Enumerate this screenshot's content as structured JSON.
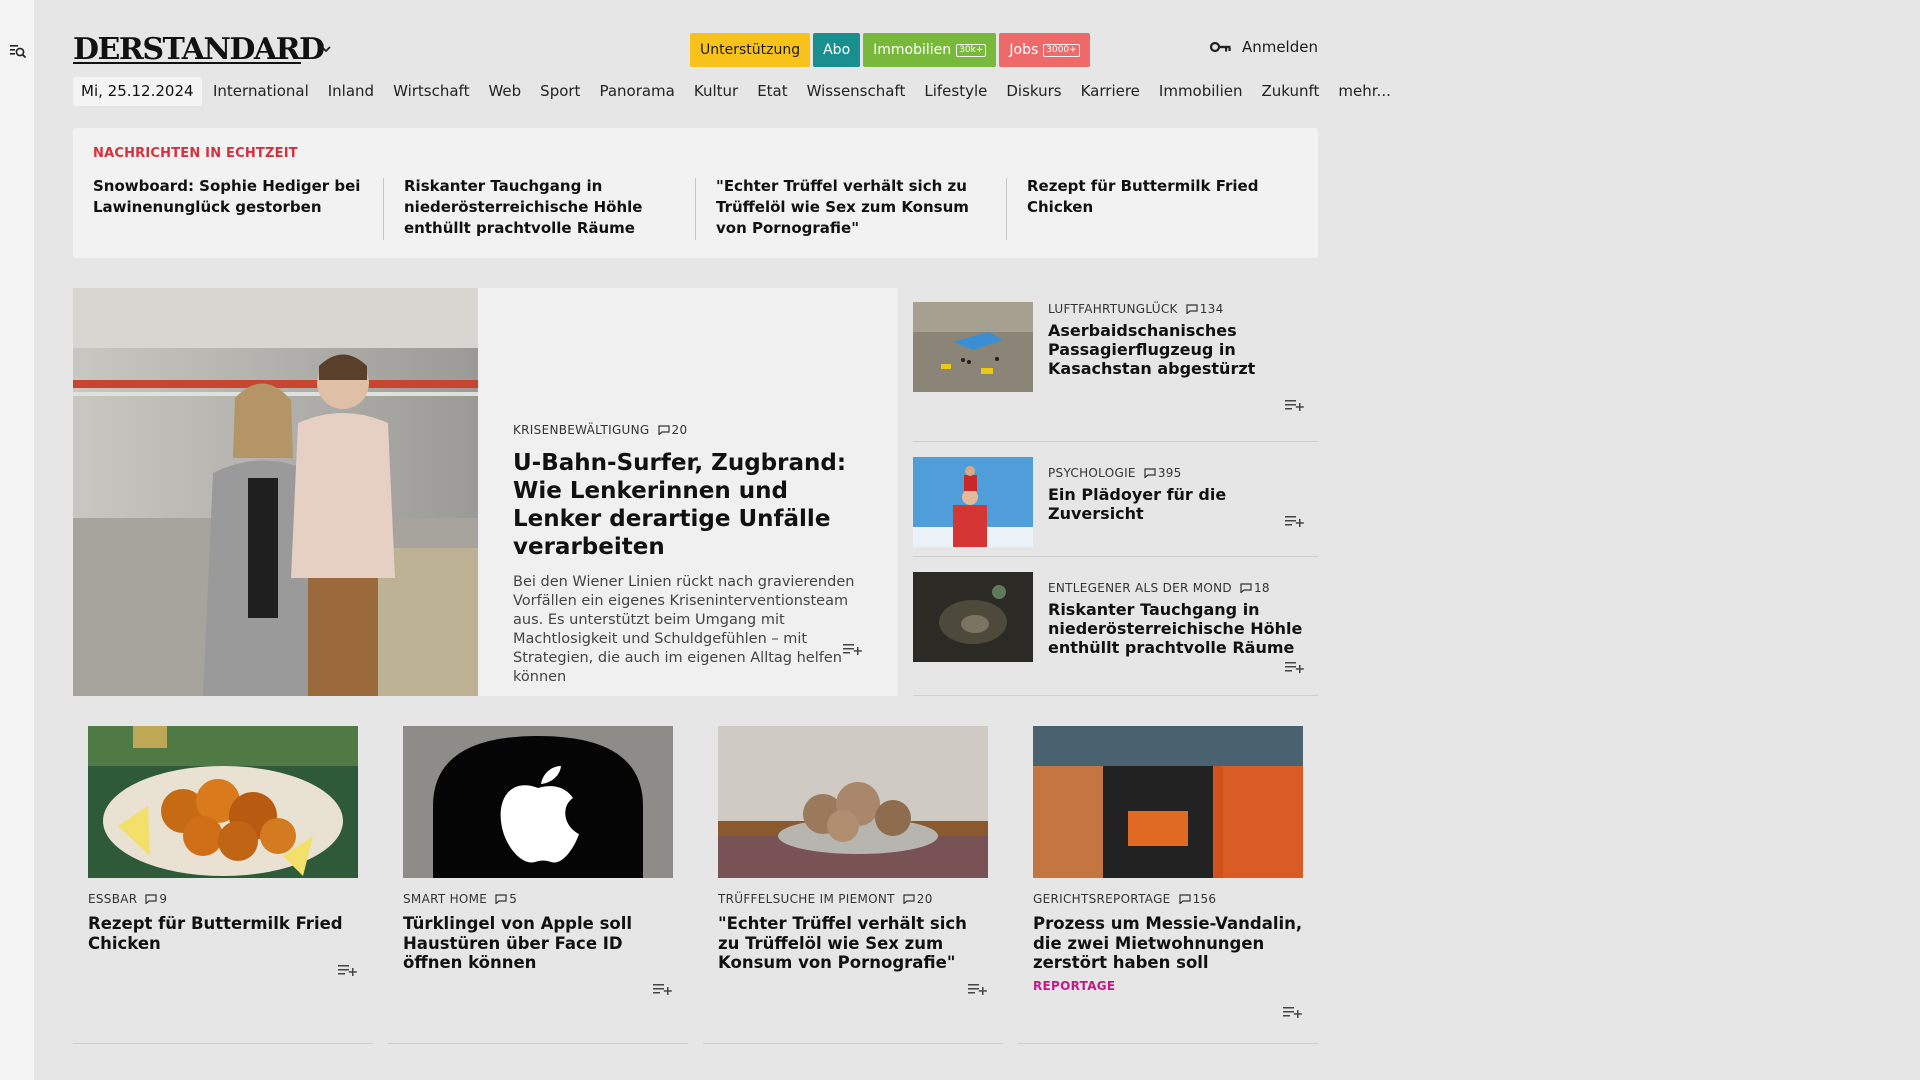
{
  "header": {
    "logo": "DERSTANDARD",
    "promo": [
      {
        "label": "Unterstützung",
        "bg": "#f7c31b",
        "fg": "#1c1c1c",
        "tag": ""
      },
      {
        "label": "Abo",
        "bg": "#1a8f8f",
        "fg": "#ffffff",
        "tag": ""
      },
      {
        "label": "Immobilien",
        "bg": "#78b93c",
        "fg": "#ffffff",
        "tag": "30k+"
      },
      {
        "label": "Jobs",
        "bg": "#ee6a6a",
        "fg": "#ffffff",
        "tag": "3000+"
      }
    ],
    "login": "Anmelden"
  },
  "nav": {
    "date": "Mi, 25.12.2024",
    "items": [
      "International",
      "Inland",
      "Wirtschaft",
      "Web",
      "Sport",
      "Panorama",
      "Kultur",
      "Etat",
      "Wissenschaft",
      "Lifestyle",
      "Diskurs",
      "Karriere",
      "Immobilien",
      "Zukunft",
      "mehr..."
    ]
  },
  "ticker": {
    "label": "NACHRICHTEN IN ECHTZEIT",
    "items": [
      "Snowboard: Sophie Hediger bei Lawi­nenunglück gestorben",
      "Riskanter Tauchgang in niederöster­reichische Höhle enthüllt prachtvolle Räume",
      "\"Echter Trüffel verhält sich zu Trüf­felöl wie Sex zum Konsum von Pornografie\"",
      "Rezept für Buttermilk Fried Chicken"
    ]
  },
  "hero": {
    "kicker": "KRISENBEWÄLTIGUNG",
    "comments": "20",
    "title": "U-Bahn-Surfer, Zugbrand: Wie Lenkerinnen und Lenker derartige Unfälle verarbeiten",
    "lead": "Bei den Wiener Linien rückt nach gravierenden Vorfällen ein eigenes Kriseninterventionsteam aus. Es unterstützt beim Umgang mit Machtlosigkeit und Schuldgefühlen – mit Strategien, die auch im eigenen Alltag helfen können"
  },
  "side": [
    {
      "kicker": "LUFTFAHRTUNGLÜCK",
      "comments": "134",
      "title": "Aserbaidschanisches Passagier­flugzeug in Kasachstan abgestürzt"
    },
    {
      "kicker": "PSYCHOLOGIE",
      "comments": "395",
      "title": "Ein Plädoyer für die Zuversicht"
    },
    {
      "kicker": "ENTLEGENER ALS DER MOND",
      "comments": "18",
      "title": "Riskanter Tauchgang in niederös­terreichische Höhle enthüllt prachtvolle Räume"
    }
  ],
  "cards": [
    {
      "kicker": "ESSBAR",
      "comments": "9",
      "title": "Rezept für Buttermilk Fried Chicken",
      "badge": ""
    },
    {
      "kicker": "SMART HOME",
      "comments": "5",
      "title": "Türklingel von Apple soll Haustüren über Face ID öffnen können",
      "badge": ""
    },
    {
      "kicker": "TRÜFFELSUCHE IM PIEMONT",
      "comments": "20",
      "title": "\"Echter Trüffel verhält sich zu Trüffelöl wie Sex zum Konsum von Pornografie\"",
      "badge": ""
    },
    {
      "kicker": "GERICHTSREPORTAGE",
      "comments": "156",
      "title": "Prozess um Messie-Vandalin, die zwei Mietwohnungen zerstört haben soll",
      "badge": "REPORTAGE"
    }
  ],
  "icons": {
    "rail": "search-menu-icon",
    "login": "key-icon",
    "logo_menu": "chevron-down-icon",
    "comment": "comment-icon",
    "save": "playlist-add-icon"
  }
}
